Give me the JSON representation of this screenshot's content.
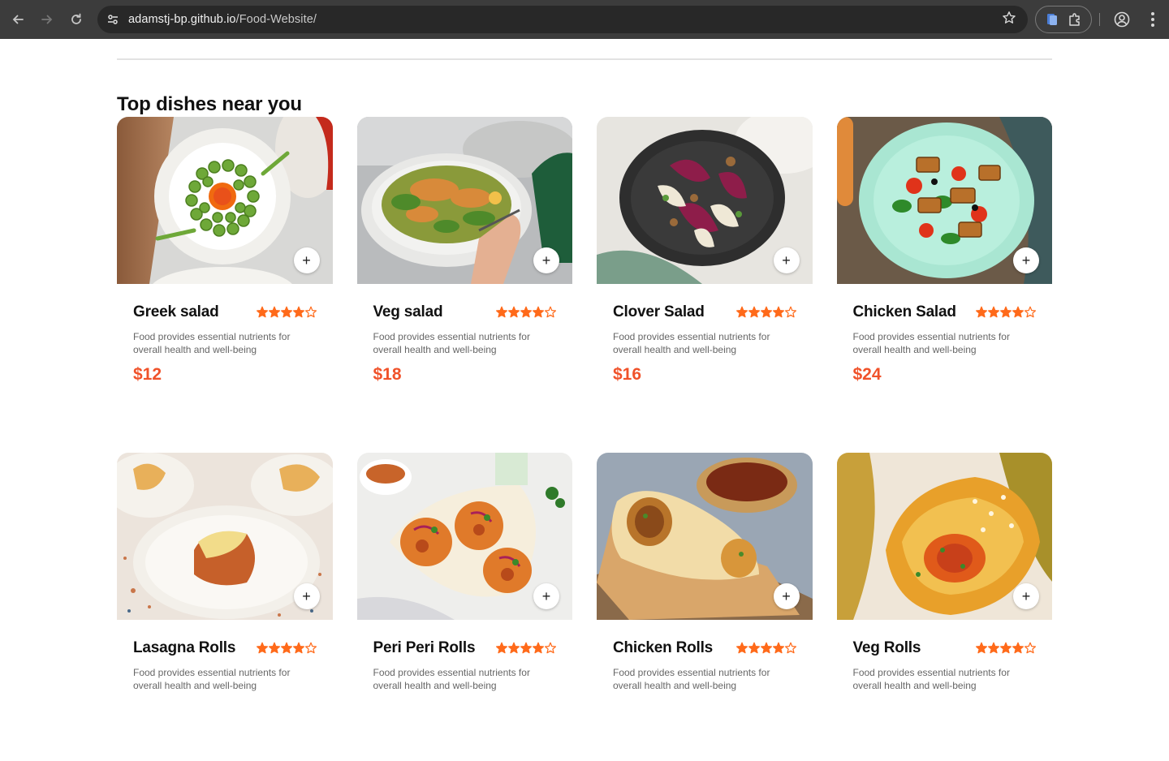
{
  "browser": {
    "url_host": "adamstj-bp.github.io",
    "url_path": "/Food-Website/"
  },
  "section": {
    "title": "Top dishes near you"
  },
  "dishes": [
    {
      "name": "Greek salad",
      "rating": 4,
      "rating_max": 5,
      "description": "Food provides essential nutrients for overall health and well-being",
      "price": "$12"
    },
    {
      "name": "Veg salad",
      "rating": 4,
      "rating_max": 5,
      "description": "Food provides essential nutrients for overall health and well-being",
      "price": "$18"
    },
    {
      "name": "Clover Salad",
      "rating": 4,
      "rating_max": 5,
      "description": "Food provides essential nutrients for overall health and well-being",
      "price": "$16"
    },
    {
      "name": "Chicken Salad",
      "rating": 4,
      "rating_max": 5,
      "description": "Food provides essential nutrients for overall health and well-being",
      "price": "$24"
    },
    {
      "name": "Lasagna Rolls",
      "rating": 4,
      "rating_max": 5,
      "description": "Food provides essential nutrients for overall health and well-being"
    },
    {
      "name": "Peri Peri Rolls",
      "rating": 4,
      "rating_max": 5,
      "description": "Food provides essential nutrients for overall health and well-being"
    },
    {
      "name": "Chicken Rolls",
      "rating": 4,
      "rating_max": 5,
      "description": "Food provides essential nutrients for overall health and well-being"
    },
    {
      "name": "Veg Rolls",
      "rating": 4,
      "rating_max": 5,
      "description": "Food provides essential nutrients for overall health and well-being"
    }
  ],
  "colors": {
    "accent": "#f0522a",
    "star": "#ff6a1a"
  },
  "icons": {
    "add": "plus-icon",
    "rating": "star-icon"
  }
}
